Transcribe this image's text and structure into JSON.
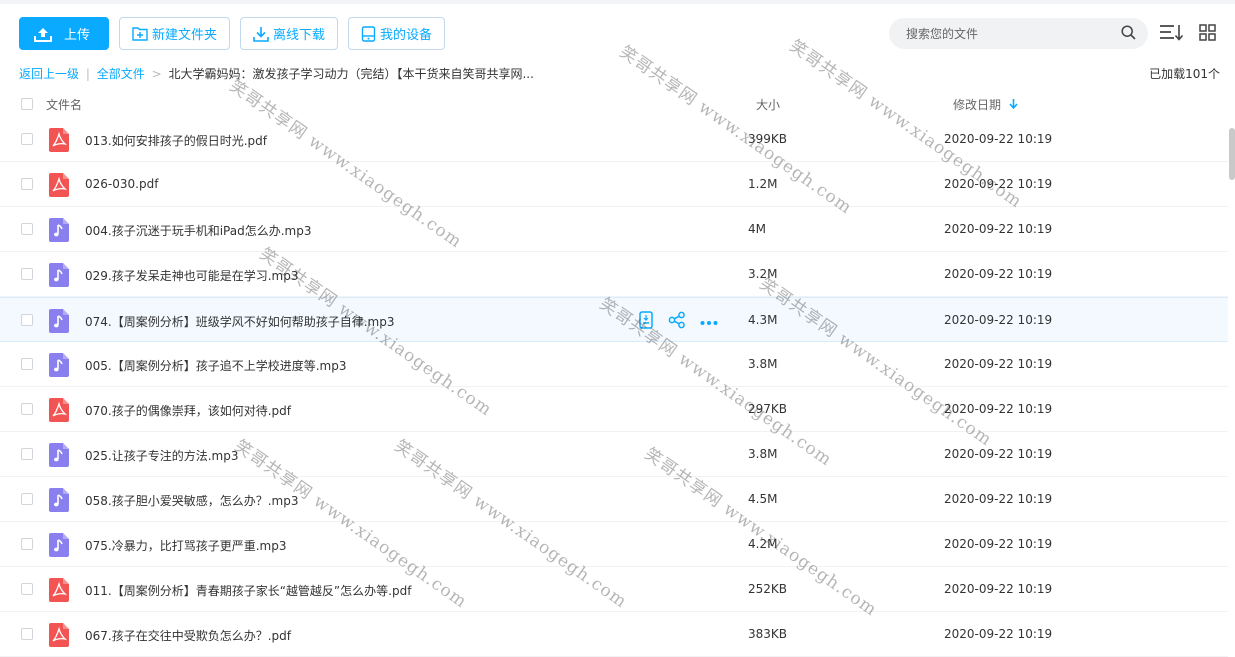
{
  "toolbar": {
    "upload_label": "上传",
    "new_folder_label": "新建文件夹",
    "offline_download_label": "离线下载",
    "my_devices_label": "我的设备"
  },
  "search": {
    "placeholder": "搜索您的文件"
  },
  "breadcrumb": {
    "back_label": "返回上一级",
    "all_files_label": "全部文件",
    "separator": "|",
    "arrow": ">",
    "current": "北大学霸妈妈：激发孩子学习动力（完结）【本干货来自笑哥共享网..."
  },
  "loaded_count": "已加载101个",
  "columns": {
    "name": "文件名",
    "size": "大小",
    "date": "修改日期"
  },
  "files": [
    {
      "name": "013.如何安排孩子的假日时光.pdf",
      "type": "pdf",
      "size": "399KB",
      "date": "2020-09-22 10:19"
    },
    {
      "name": "026-030.pdf",
      "type": "pdf",
      "size": "1.2M",
      "date": "2020-09-22 10:19"
    },
    {
      "name": "004.孩子沉迷于玩手机和iPad怎么办.mp3",
      "type": "mp3",
      "size": "4M",
      "date": "2020-09-22 10:19"
    },
    {
      "name": "029.孩子发呆走神也可能是在学习.mp3",
      "type": "mp3",
      "size": "3.2M",
      "date": "2020-09-22 10:19"
    },
    {
      "name": "074.【周案例分析】班级学风不好如何帮助孩子自律.mp3",
      "type": "mp3",
      "size": "4.3M",
      "date": "2020-09-22 10:19"
    },
    {
      "name": "005.【周案例分析】孩子追不上学校进度等.mp3",
      "type": "mp3",
      "size": "3.8M",
      "date": "2020-09-22 10:19"
    },
    {
      "name": "070.孩子的偶像崇拜，该如何对待.pdf",
      "type": "pdf",
      "size": "297KB",
      "date": "2020-09-22 10:19"
    },
    {
      "name": "025.让孩子专注的方法.mp3",
      "type": "mp3",
      "size": "3.8M",
      "date": "2020-09-22 10:19"
    },
    {
      "name": "058.孩子胆小爱哭敏感，怎么办？.mp3",
      "type": "mp3",
      "size": "4.5M",
      "date": "2020-09-22 10:19"
    },
    {
      "name": "075.冷暴力，比打骂孩子更严重.mp3",
      "type": "mp3",
      "size": "4.2M",
      "date": "2020-09-22 10:19"
    },
    {
      "name": "011.【周案例分析】青春期孩子家长“越管越反”怎么办等.pdf",
      "type": "pdf",
      "size": "252KB",
      "date": "2020-09-22 10:19"
    },
    {
      "name": "067.孩子在交往中受欺负怎么办？.pdf",
      "type": "pdf",
      "size": "383KB",
      "date": "2020-09-22 10:19"
    }
  ],
  "hovered_row": 4,
  "watermark_text": "笑哥共享网 www.xiaogegh.com",
  "colors": {
    "accent": "#09AAFF",
    "pdf": "#F25353",
    "mp3": "#8A7FEF"
  },
  "icons": {
    "upload": "upload-icon",
    "new_folder": "folder-plus-icon",
    "offline": "download-icon",
    "devices": "device-icon",
    "search": "search-icon",
    "sort": "sort-icon",
    "grid": "grid-view-icon",
    "sort_arrow": "arrow-down-icon"
  }
}
